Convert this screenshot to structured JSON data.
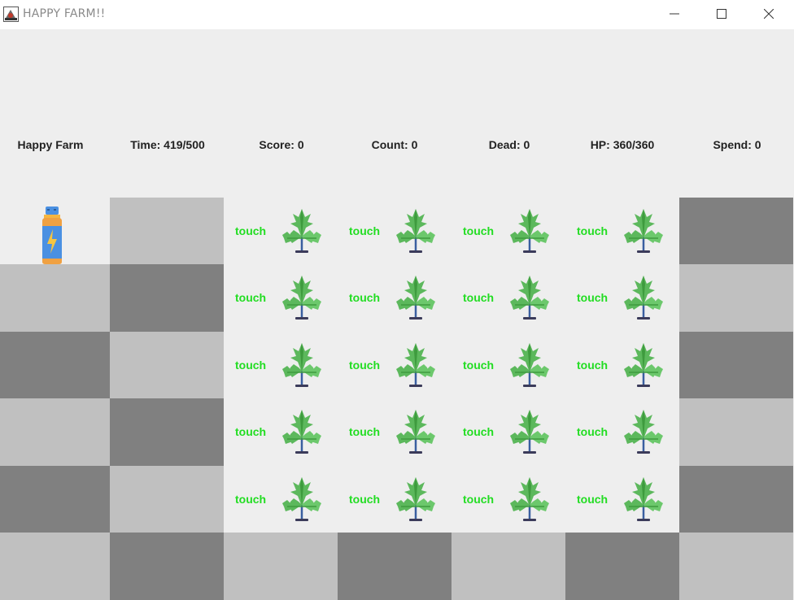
{
  "window": {
    "title": "HAPPY FARM!!",
    "controls": [
      "minimize",
      "maximize",
      "close"
    ]
  },
  "stats": {
    "name": "Happy Farm",
    "time": "Time: 419/500",
    "score": "Score: 0",
    "count": "Count: 0",
    "dead": "Dead: 0",
    "hp": "HP: 360/360",
    "spend": "Spend: 0"
  },
  "field": {
    "plot_label": "touch",
    "plant_icon": "cannabis-plant-icon",
    "item_icon": "energy-drink-bottle-icon",
    "colors": {
      "dark": "#808080",
      "light": "#c0c0c0",
      "plot_bg": "#eeeeee",
      "touch": "#22dd22"
    }
  }
}
